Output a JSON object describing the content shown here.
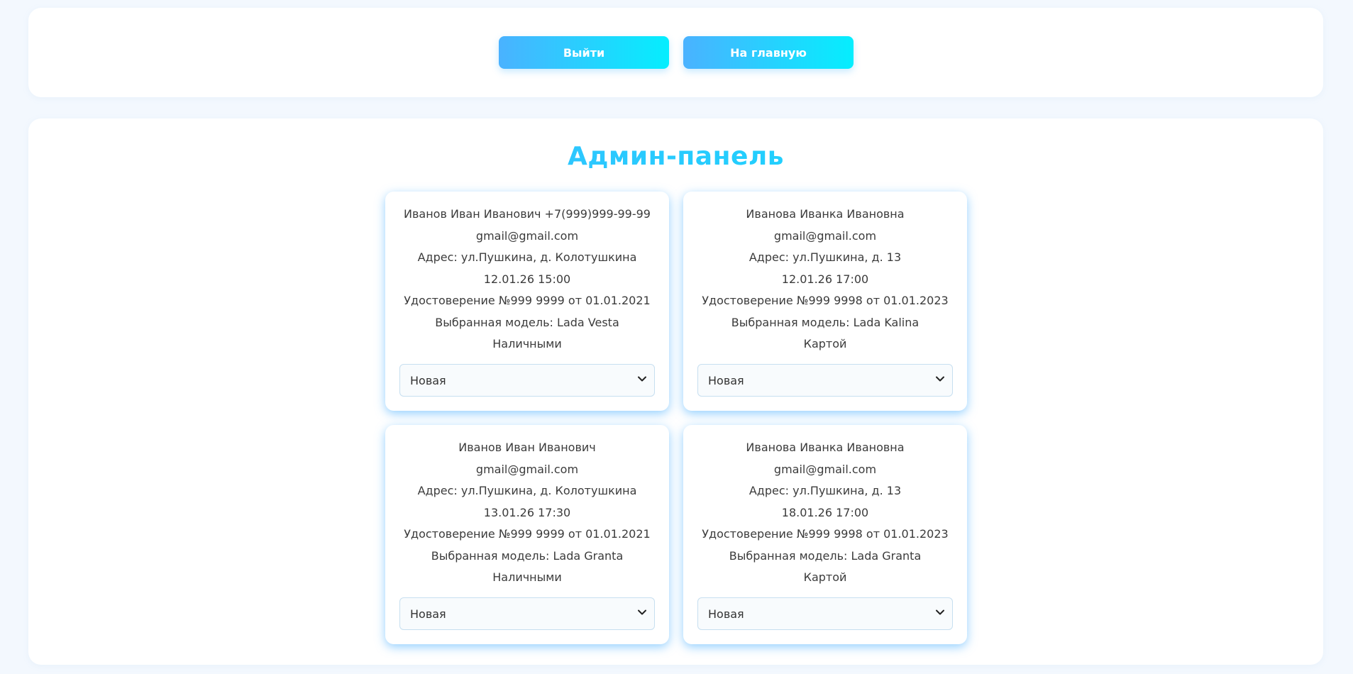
{
  "header": {
    "logout_label": "Выйти",
    "home_label": "На главную"
  },
  "main": {
    "title": "Админ-панель",
    "cards": [
      {
        "lines": [
          "Иванов Иван Иванович +7(999)999-99-99",
          "gmail@gmail.com",
          "Адрес: ул.Пушкина, д. Колотушкина",
          "12.01.26 15:00",
          "Удостоверение №999 9999 от 01.01.2021",
          "Выбранная модель: Lada Vesta",
          "Наличными"
        ],
        "status": "Новая"
      },
      {
        "lines": [
          "Иванова Иванка Ивановна",
          "gmail@gmail.com",
          "Адрес: ул.Пушкина, д. 13",
          "12.01.26 17:00",
          "Удостоверение №999 9998 от 01.01.2023",
          "Выбранная модель: Lada Kalina",
          "Картой"
        ],
        "status": "Новая"
      },
      {
        "lines": [
          "Иванов Иван Иванович",
          "gmail@gmail.com",
          "Адрес: ул.Пушкина, д. Колотушкина",
          "13.01.26 17:30",
          "Удостоверение №999 9999 от 01.01.2021",
          "Выбранная модель: Lada Granta",
          "Наличными"
        ],
        "status": "Новая"
      },
      {
        "lines": [
          "Иванова Иванка Ивановна",
          "gmail@gmail.com",
          "Адрес: ул.Пушкина, д. 13",
          "18.01.26 17:00",
          "Удостоверение №999 9998 от 01.01.2023",
          "Выбранная модель: Lada Granta",
          "Картой"
        ],
        "status": "Новая"
      }
    ]
  },
  "icons": {
    "select_arrow": "chevron-down-icon"
  },
  "colors": {
    "accent_start": "#4ab2ff",
    "accent_end": "#05eefe",
    "page_background": "#f3f8fe"
  }
}
